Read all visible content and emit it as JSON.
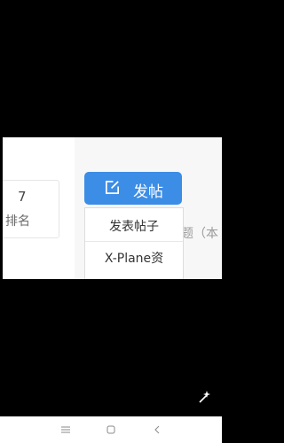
{
  "stats": {
    "number": "7",
    "label": "排名"
  },
  "post_button": {
    "label": "发帖",
    "icon": "edit-icon",
    "color": "#3c8de6"
  },
  "dropdown": {
    "items": [
      "发表帖子",
      "X-Plane资"
    ]
  },
  "side_text": "题（本",
  "navigation": {
    "icons": [
      "menu-icon",
      "home-square-icon",
      "back-chevron-icon"
    ]
  }
}
